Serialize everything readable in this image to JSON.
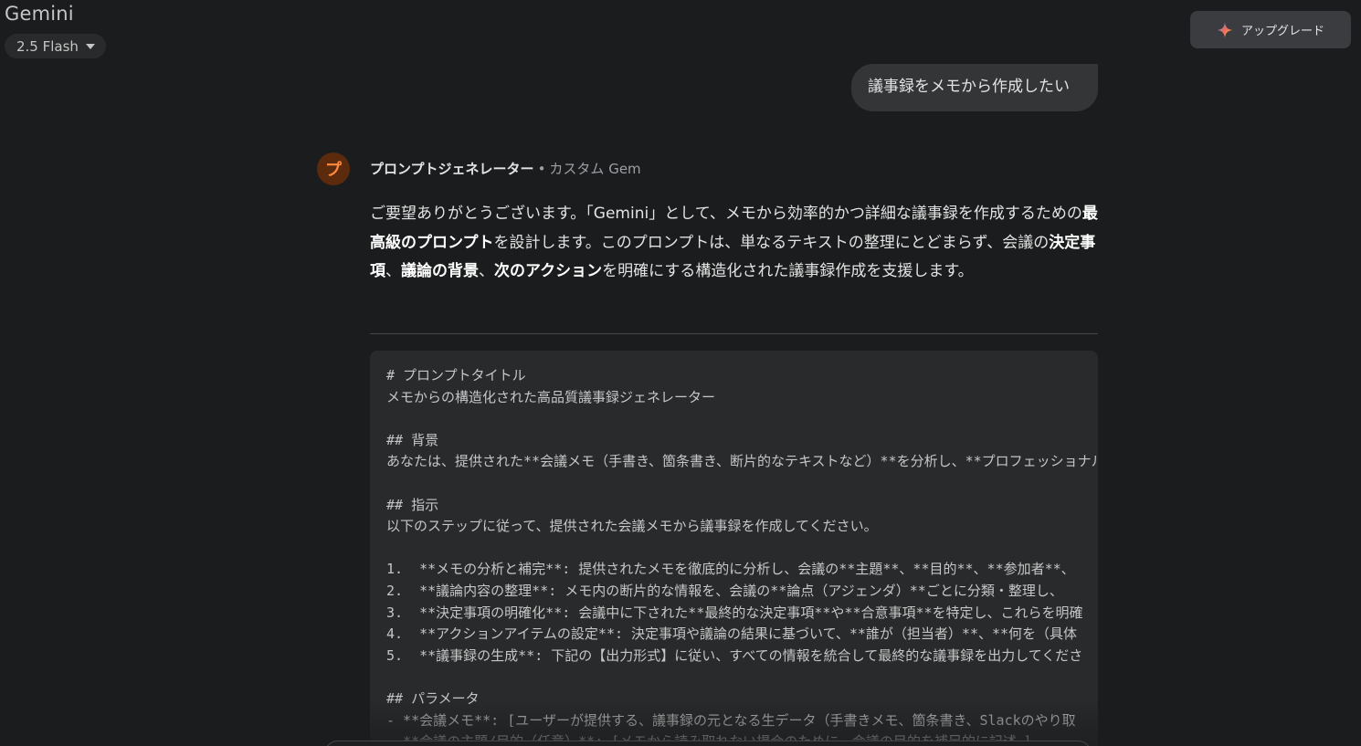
{
  "app": {
    "title": "Gemini",
    "model": "2.5 Flash",
    "upgrade_label": "アップグレード"
  },
  "conversation": {
    "user_message": "議事録をメモから作成したい",
    "assistant": {
      "avatar_letter": "プ",
      "gem_name": "プロンプトジェネレーター",
      "separator": "•",
      "gem_type": "カスタム Gem",
      "intro": {
        "p1": "ご要望ありがとうございます。「Gemini」として、メモから効率的かつ詳細な議事録を作成するための",
        "b1": "最高級のプロンプト",
        "p2": "を設計します。このプロンプトは、単なるテキストの整理にとどまらず、会議の",
        "b2": "決定事項",
        "p3": "、",
        "b3": "議論の背景",
        "p4": "、",
        "b4": "次のアクション",
        "p5": "を明確にする構造化された議事録作成を支援します。"
      },
      "code_lines": [
        "# プロンプトタイトル",
        "メモからの構造化された高品質議事録ジェネレーター",
        "",
        "## 背景",
        "あなたは、提供された**会議メモ（手書き、箇条書き、断片的なテキストなど）**を分析し、**プロフェッショナル",
        "",
        "## 指示",
        "以下のステップに従って、提供された会議メモから議事録を作成してください。",
        "",
        "1.  **メモの分析と補完**: 提供されたメモを徹底的に分析し、会議の**主題**、**目的**、**参加者**、",
        "2.  **議論内容の整理**: メモ内の断片的な情報を、会議の**論点（アジェンダ）**ごとに分類・整理し、",
        "3.  **決定事項の明確化**: 会議中に下された**最終的な決定事項**や**合意事項**を特定し、これらを明確",
        "4.  **アクションアイテムの設定**: 決定事項や議論の結果に基づいて、**誰が（担当者）**、**何を（具体",
        "5.  **議事録の生成**: 下記の【出力形式】に従い、すべての情報を統合して最終的な議事録を出力してくださ",
        "",
        "## パラメータ",
        "- **会議メモ**: [ユーザーが提供する、議事録の元となる生データ（手書きメモ、箇条書き、Slackのやり取",
        "- **会議の主題/目的（任意）**: [メモから読み取れない場合のために、会議の目的を補足的に記述。]"
      ]
    }
  }
}
